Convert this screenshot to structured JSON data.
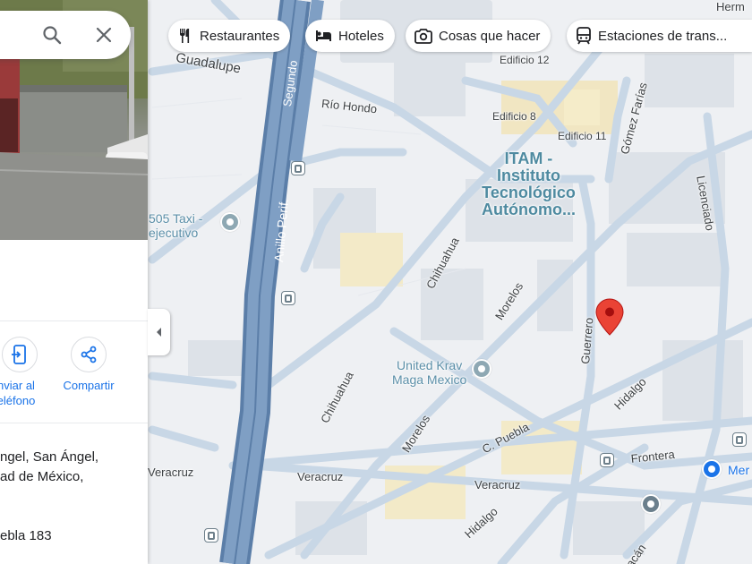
{
  "search": {
    "search_icon": "search-icon",
    "close_icon": "close-icon"
  },
  "panel": {
    "actions": [
      {
        "label_line1": "nviar al",
        "label_line2": "eléfono",
        "icon": "send-to-phone-icon"
      },
      {
        "label_line1": "Compartir",
        "icon": "share-icon"
      }
    ],
    "address_lines": [
      "ngel, San Ángel,",
      "ad de México,"
    ],
    "plus_code": "ebla 183"
  },
  "chips": [
    {
      "label": "Restaurantes",
      "icon": "restaurant-icon"
    },
    {
      "label": "Hoteles",
      "icon": "hotel-icon"
    },
    {
      "label": "Cosas que hacer",
      "icon": "camera-icon"
    },
    {
      "label": "Estaciones de trans...",
      "icon": "transit-icon"
    }
  ],
  "map": {
    "streets": {
      "segundo": "Segundo",
      "anillo": "Anillo Perif.",
      "guadalupe": "Guadalupe",
      "rio_hondo": "Río Hondo",
      "gomez_farias": "Gómez Farías",
      "licenciado": "Licenciado",
      "chihuahua1": "Chihuahua",
      "chihuahua2": "Chihuahua",
      "morelos1": "Morelos",
      "morelos2": "Morelos",
      "guerrero": "Guerrero",
      "hidalgo1": "Hidalgo",
      "hidalgo2": "Hidalgo",
      "c_puebla": "C. Puebla",
      "frontera": "Frontera",
      "veracruz1": "Veracruz",
      "veracruz2": "Veracruz",
      "veracruz3": "Veracruz",
      "herm": "Herm",
      "acan": "acán"
    },
    "buildings": {
      "edificio12": "Edificio 12",
      "edificio8": "Edificio 8",
      "edificio11": "Edificio 11"
    },
    "pois": {
      "itam_1": "ITAM -",
      "itam_2": "Instituto",
      "itam_3": "Tecnológico",
      "itam_4": "Autónomo...",
      "taxi_1": "505 Taxi -",
      "taxi_2": "ejecutivo",
      "krav_1": "United Krav",
      "krav_2": "Maga Mexico",
      "mer": "Mer"
    },
    "colors": {
      "pin": "#ea4335",
      "road": "#c9d8e5",
      "highway": "#6d8fb3",
      "block": "#dfe3e8",
      "land": "#eef0f3"
    }
  }
}
